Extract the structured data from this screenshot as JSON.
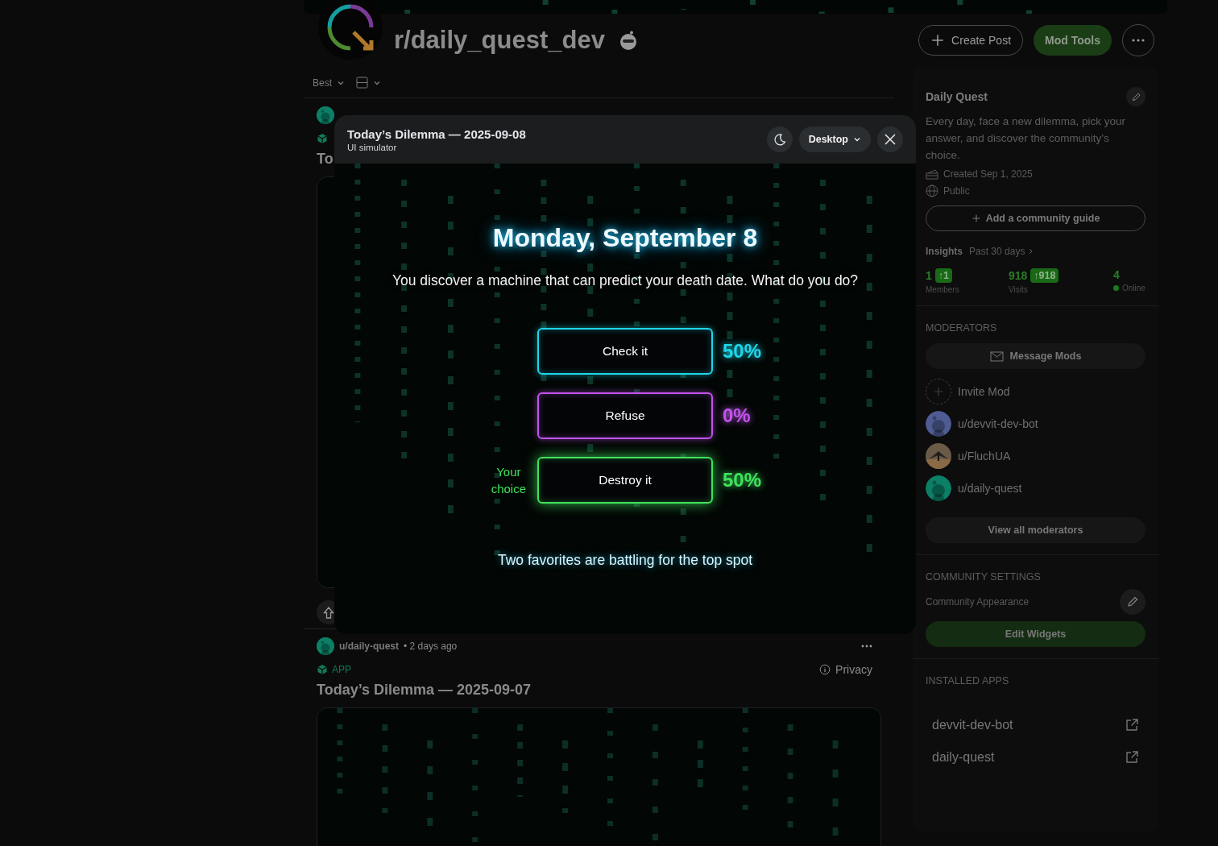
{
  "community": {
    "name": "r/daily_quest_dev"
  },
  "header_actions": {
    "create_post": "Create Post",
    "mod_tools": "Mod Tools"
  },
  "feed": {
    "sort": "Best"
  },
  "posts": [
    {
      "title": "To"
    },
    {
      "author": "u/daily-quest",
      "time": "• 2 days ago",
      "badge": "APP",
      "privacy": "Privacy",
      "title": "Today’s Dilemma — 2025-09-07"
    }
  ],
  "simulator": {
    "title": "Today’s Dilemma — 2025-09-08",
    "subtitle": "UI simulator",
    "view": "Desktop"
  },
  "dilemma": {
    "date": "Monday, September 8",
    "question": "You discover a machine that can predict your death date. What do you do?",
    "choice_label": "Your choice",
    "footer": "Two favorites are battling for the top spot",
    "options": [
      {
        "label": "Check it",
        "percent": "50%",
        "color": "#1fd6ea",
        "selected": false
      },
      {
        "label": "Refuse",
        "percent": "0%",
        "color": "#c353ec",
        "selected": false
      },
      {
        "label": "Destroy it",
        "percent": "50%",
        "color": "#3fe25c",
        "selected": true
      }
    ]
  },
  "sidebar": {
    "title": "Daily Quest",
    "description": "Every day, face a new dilemma, pick your answer, and discover the community’s choice.",
    "created": "Created Sep 1, 2025",
    "visibility": "Public",
    "guide_button": "Add a community guide",
    "insights": {
      "label": "Insights",
      "period": "Past 30 days",
      "stats": [
        {
          "kind": "delta",
          "value": "1",
          "delta": "↑1",
          "label": "Members"
        },
        {
          "kind": "delta",
          "value": "918",
          "delta": "↑918",
          "label": "Visits"
        },
        {
          "kind": "online",
          "value": "4",
          "label": "Online"
        }
      ]
    },
    "moderators": {
      "heading": "MODERATORS",
      "message_button": "Message Mods",
      "invite": "Invite Mod",
      "view_all": "View all moderators",
      "mods": [
        {
          "name": "u/devvit-dev-bot",
          "kind": "snoo",
          "color": "#4f5c93"
        },
        {
          "name": "u/FluchUA",
          "kind": "picture"
        },
        {
          "name": "u/daily-quest",
          "kind": "snoo",
          "color": "#0c7f66"
        }
      ]
    },
    "settings": {
      "heading": "COMMUNITY SETTINGS",
      "appearance": "Community Appearance",
      "edit_widgets": "Edit Widgets"
    },
    "apps": {
      "heading": "INSTALLED APPS",
      "items": [
        "devvit-dev-bot",
        "daily-quest"
      ]
    }
  }
}
